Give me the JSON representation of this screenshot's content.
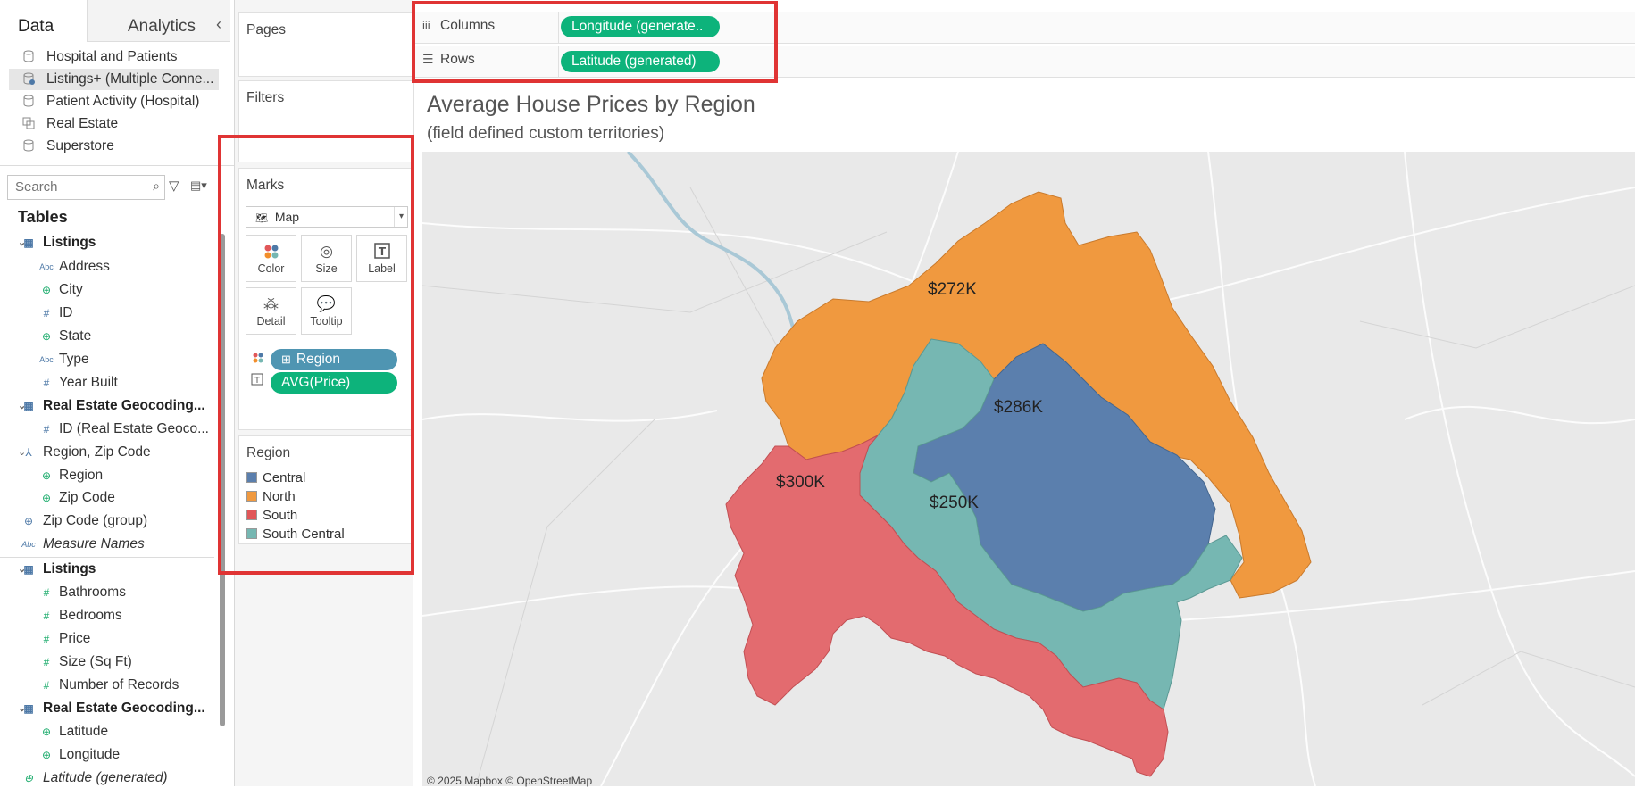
{
  "left_pane": {
    "tabs": {
      "data": "Data",
      "analytics": "Analytics"
    },
    "collapse_icon": "chevron-left-icon",
    "datasources": [
      {
        "label": "Hospital and Patients",
        "icon": "database-icon"
      },
      {
        "label": "Listings+ (Multiple Conne...",
        "icon": "database-join-icon",
        "selected": true
      },
      {
        "label": "Patient Activity (Hospital)",
        "icon": "database-icon"
      },
      {
        "label": "Real Estate",
        "icon": "database-multi-icon"
      },
      {
        "label": "Superstore",
        "icon": "database-icon"
      }
    ],
    "search_placeholder": "Search",
    "tables_title": "Tables",
    "fields": [
      {
        "label": "Listings",
        "type": "table"
      },
      {
        "label": "Address",
        "type": "abc"
      },
      {
        "label": "City",
        "type": "geo"
      },
      {
        "label": "ID",
        "type": "number"
      },
      {
        "label": "State",
        "type": "geo"
      },
      {
        "label": "Type",
        "type": "abc"
      },
      {
        "label": "Year Built",
        "type": "number"
      },
      {
        "label": "Real Estate Geocoding...",
        "type": "table"
      },
      {
        "label": "ID (Real Estate Geoco...",
        "type": "number"
      },
      {
        "label": "Region, Zip Code",
        "type": "hierarchy"
      },
      {
        "label": "Region",
        "type": "geo"
      },
      {
        "label": "Zip Code",
        "type": "geo"
      },
      {
        "label": "Zip Code (group)",
        "type": "group"
      },
      {
        "label": "Measure Names",
        "type": "abc"
      },
      {
        "label": "Listings",
        "type": "table"
      },
      {
        "label": "Bathrooms",
        "type": "measure"
      },
      {
        "label": "Bedrooms",
        "type": "measure"
      },
      {
        "label": "Price",
        "type": "measure"
      },
      {
        "label": "Size (Sq Ft)",
        "type": "measure"
      },
      {
        "label": "Number of Records",
        "type": "measure"
      },
      {
        "label": "Real Estate Geocoding...",
        "type": "table"
      },
      {
        "label": "Latitude",
        "type": "geo-measure"
      },
      {
        "label": "Longitude",
        "type": "geo-measure"
      },
      {
        "label": "Latitude (generated)",
        "type": "geo-measure"
      }
    ]
  },
  "cards": {
    "pages": "Pages",
    "filters": "Filters",
    "marks": {
      "title": "Marks",
      "type": "Map",
      "buttons": {
        "color": "Color",
        "size": "Size",
        "label": "Label",
        "detail": "Detail",
        "tooltip": "Tooltip"
      },
      "pills": {
        "region": "Region",
        "avg_price": "AVG(Price)"
      }
    },
    "legend": {
      "title": "Region",
      "items": [
        {
          "label": "Central",
          "color": "#5b7fad"
        },
        {
          "label": "North",
          "color": "#f0993f"
        },
        {
          "label": "South",
          "color": "#e15759"
        },
        {
          "label": "South Central",
          "color": "#76b7b2"
        }
      ]
    }
  },
  "shelves": {
    "columns": {
      "label": "Columns",
      "pill": "Longitude (generate.."
    },
    "rows": {
      "label": "Rows",
      "pill": "Latitude (generated)"
    }
  },
  "view": {
    "title": "Average House Prices by Region",
    "subtitle": "(field defined custom territories)",
    "map_labels": {
      "north": "$272K",
      "central": "$286K",
      "south": "$300K",
      "south_central": "$250K"
    },
    "credit": "© 2025 Mapbox © OpenStreetMap"
  }
}
